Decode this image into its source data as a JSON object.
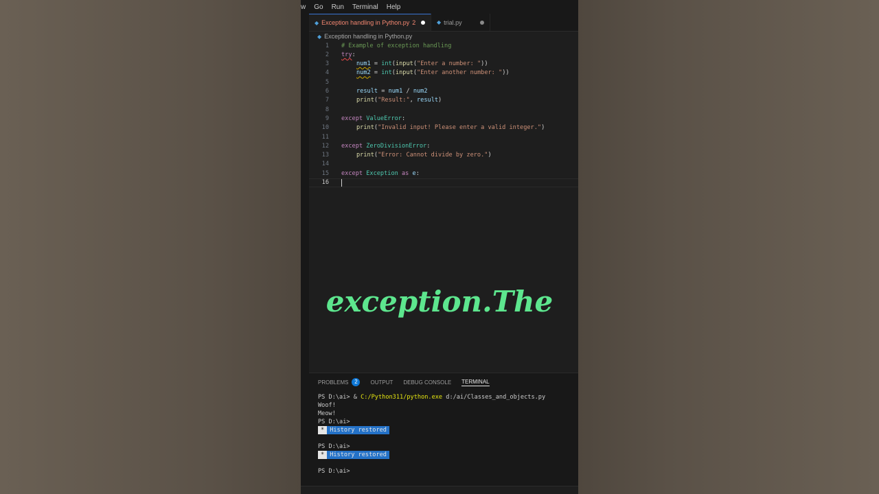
{
  "menubar": {
    "items": [
      "w",
      "Go",
      "Run",
      "Terminal",
      "Help"
    ]
  },
  "tabs": [
    {
      "label": "Exception handling in Python.py",
      "errors": "2",
      "active": true
    },
    {
      "label": "trial.py",
      "errors": "",
      "active": false
    }
  ],
  "breadcrumb": "Exception handling in Python.py",
  "editor": {
    "line_numbers": [
      "1",
      "2",
      "3",
      "4",
      "5",
      "6",
      "7",
      "8",
      "9",
      "10",
      "11",
      "12",
      "13",
      "14",
      "15",
      "16"
    ],
    "current_line": "16",
    "tokens": {
      "l1": "# Example of exception handling",
      "l2_kw": "try",
      "l2_colon": ":",
      "l3_var": "num1",
      "l3_eq": " = ",
      "l3_int": "int",
      "l3_p1": "(",
      "l3_input": "input",
      "l3_p2": "(",
      "l3_str": "\"Enter a number: \"",
      "l3_p3": "))",
      "l4_var": "num2",
      "l4_eq": " = ",
      "l4_int": "int",
      "l4_p1": "(",
      "l4_input": "input",
      "l4_p2": "(",
      "l4_str": "\"Enter another number: \"",
      "l4_p3": "))",
      "l6_var": "result",
      "l6_eq": " = ",
      "l6_a": "num1",
      "l6_op": " / ",
      "l6_b": "num2",
      "l7_print": "print",
      "l7_p1": "(",
      "l7_str": "\"Result:\"",
      "l7_comma": ", ",
      "l7_var": "result",
      "l7_p2": ")",
      "l9_kw": "except",
      "l9_cls": "ValueError",
      "l9_colon": ":",
      "l10_print": "print",
      "l10_p1": "(",
      "l10_str": "\"Invalid input! Please enter a valid integer.\"",
      "l10_p2": ")",
      "l12_kw": "except",
      "l12_cls": "ZeroDivisionError",
      "l12_colon": ":",
      "l13_print": "print",
      "l13_p1": "(",
      "l13_str": "\"Error: Cannot divide by zero.\"",
      "l13_p2": ")",
      "l15_kw": "except",
      "l15_cls": "Exception",
      "l15_as": "as",
      "l15_var": "e",
      "l15_colon": ":"
    }
  },
  "caption": "exception.The",
  "panel": {
    "tabs": [
      {
        "label": "PROBLEMS",
        "badge": "2"
      },
      {
        "label": "OUTPUT"
      },
      {
        "label": "DEBUG CONSOLE"
      },
      {
        "label": "TERMINAL"
      }
    ]
  },
  "terminal": {
    "prompt": "PS D:\\ai>",
    "cmd_amp": " & ",
    "cmd_exe": "C:/Python311/python.exe",
    "cmd_arg": " d:/ai/Classes_and_objects.py",
    "out1": "Woof!",
    "out2": "Meow!",
    "star": "*",
    "history": "History restored"
  },
  "colors": {
    "caption": "#5de68e",
    "accent": "#0e77d5",
    "error": "#f48771"
  }
}
